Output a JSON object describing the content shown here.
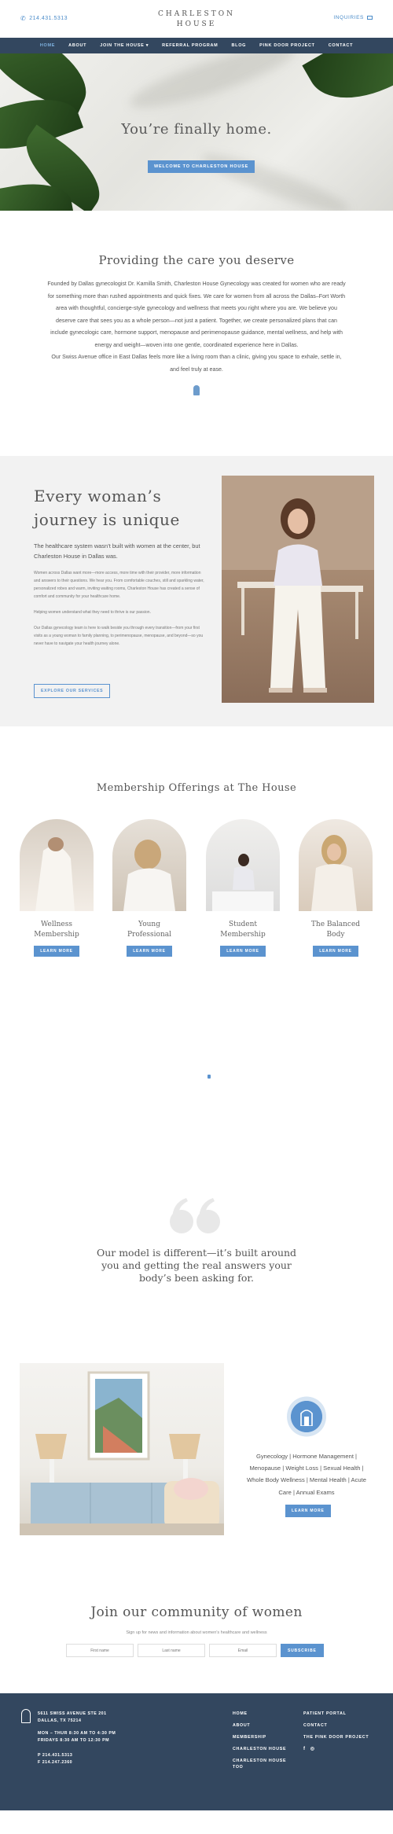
{
  "topbar": {
    "phone": "214.431.5313",
    "logo_line1": "CHARLESTON",
    "logo_line2": "HOUSE",
    "inquiries": "INQUIRIES"
  },
  "nav": {
    "items": [
      "HOME",
      "ABOUT",
      "JOIN THE HOUSE ▾",
      "REFERRAL PROGRAM",
      "BLOG",
      "PINK DOOR PROJECT",
      "CONTACT"
    ]
  },
  "hero": {
    "title": "You’re finally home.",
    "button": "WELCOME TO CHARLESTON HOUSE"
  },
  "providing": {
    "title": "Providing the care you deserve",
    "p1": "Founded by Dallas gynecologist Dr. Kamilla Smith, Charleston House Gynecology was created for women who are ready for something more than rushed appointments and quick fixes. We care for women from all across the Dallas–Fort Worth area with thoughtful, concierge-style gynecology and wellness that meets you right where you are. We believe you deserve care that sees you as a whole person—not just a patient. Together, we create personalized plans that can include gynecologic care, hormone support, menopause and perimenopause guidance, mental wellness, and help with energy and weight—woven into one gentle, coordinated experience here in Dallas.",
    "p2": "Our Swiss Avenue office in East Dallas feels more like a living room than a clinic, giving you space to exhale, settle in, and feel truly at ease."
  },
  "journey": {
    "title_line1": "Every woman’s",
    "title_line2": "journey is unique",
    "lead": "The healthcare system wasn’t built with women at the center, but Charleston House in Dallas was.",
    "small1": "Women across Dallas want more—more access, more time with their provider, more information and answers to their questions. We hear you. From comfortable couches, still and sparkling water, personalized robes and warm, inviting waiting rooms, Charleston House has created a sense of comfort and community for your healthcare home.",
    "small2": "Helping women understand what they need to thrive is our passion.",
    "small3": "Our Dallas gynecology team is here to walk beside you through every transition—from your first visits as a young woman to family planning, to perimenopause, menopause, and beyond—so you never have to navigate your health journey alone.",
    "button": "EXPLORE OUR SERVICES"
  },
  "membership": {
    "title": "Membership Offerings at The House",
    "cards": [
      {
        "line1": "Wellness",
        "line2": "Membership",
        "button": "LEARN MORE"
      },
      {
        "line1": "Young",
        "line2": "Professional",
        "button": "LEARN MORE"
      },
      {
        "line1": "Student",
        "line2": "Membership",
        "button": "LEARN MORE"
      },
      {
        "line1": "The Balanced",
        "line2": "Body",
        "button": "LEARN MORE"
      }
    ]
  },
  "quote": {
    "text": "Our model is different—it’s built around you and getting the real answers your body’s been asking for."
  },
  "model": {
    "services": "Gynecology | Hormone Management | Menopause | Weight Loss | Sexual Health | Whole Body Wellness | Mental Health | Acute Care | Annual Exams",
    "button": "LEARN MORE"
  },
  "community": {
    "title": "Join our community of women",
    "sub": "Sign up for news and information about women’s healthcare and wellness",
    "first_placeholder": "First name",
    "last_placeholder": "Last name",
    "email_placeholder": "Email",
    "button": "SUBSCRIBE"
  },
  "footer": {
    "addr1": "5611 SWISS AVENUE STE 201",
    "addr2": "DALLAS, TX 75214",
    "hours1": "MON – THUR 8:30 AM TO 4:30 PM",
    "hours2": "FRIDAYS 8:30 AM TO 12:30 PM",
    "phone": "P 214.431.5313",
    "fax": "F 214.247.2360",
    "col1": [
      "HOME",
      "ABOUT",
      "MEMBERSHIP",
      "CHARLESTON HOUSE",
      "CHARLESTON HOUSE TOO"
    ],
    "col2": [
      "PATIENT PORTAL",
      "CONTACT",
      "THE PINK DOOR PROJECT"
    ],
    "social": {
      "facebook": "f",
      "instagram": "◎"
    }
  },
  "colors": {
    "navy": "#33475f",
    "accent_blue": "#5b93cf",
    "light_gray": "#f2f2f2"
  }
}
